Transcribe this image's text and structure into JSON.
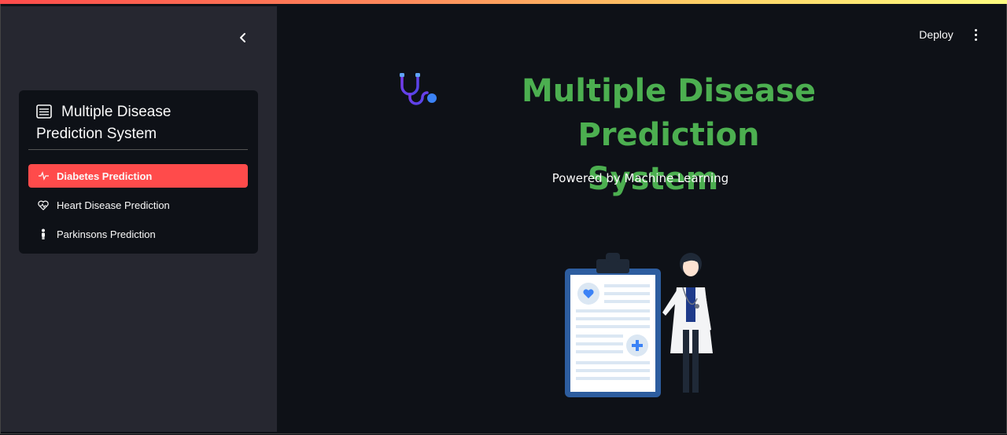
{
  "app": {
    "deploy_label": "Deploy",
    "title_line1": "Multiple Disease Prediction",
    "title_line2": "System",
    "subtitle": "Powered by Machine Learning"
  },
  "sidebar": {
    "menu_title_line1": "Multiple Disease",
    "menu_title_line2": "Prediction System",
    "items": [
      {
        "label": "Diabetes Prediction",
        "icon": "activity-icon",
        "active": true
      },
      {
        "label": "Heart Disease Prediction",
        "icon": "heart-pulse-icon",
        "active": false
      },
      {
        "label": "Parkinsons Prediction",
        "icon": "person-icon",
        "active": false
      }
    ]
  },
  "colors": {
    "accent": "#ff4b4b",
    "title_green": "#4caf50",
    "sidebar_bg": "#262730",
    "main_bg": "#0e1117"
  }
}
